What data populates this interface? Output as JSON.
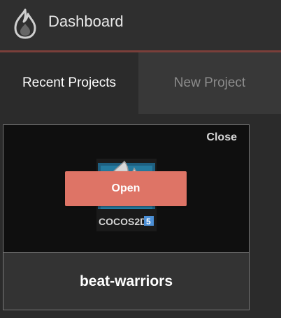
{
  "header": {
    "title": "Dashboard",
    "logo_icon": "cocos-flame-logo-icon",
    "accent_line_color": "#7a3f3a"
  },
  "tabs": [
    {
      "label": "Recent Projects",
      "active": true
    },
    {
      "label": "New Project",
      "active": false
    }
  ],
  "project_card": {
    "name": "beat-warriors",
    "open_label": "Open",
    "close_label": "Close",
    "open_button_color": "#de7466",
    "thumbnail": {
      "icon": "cocos-logo-icon",
      "text": "COCOS2D",
      "badge": "5"
    }
  }
}
